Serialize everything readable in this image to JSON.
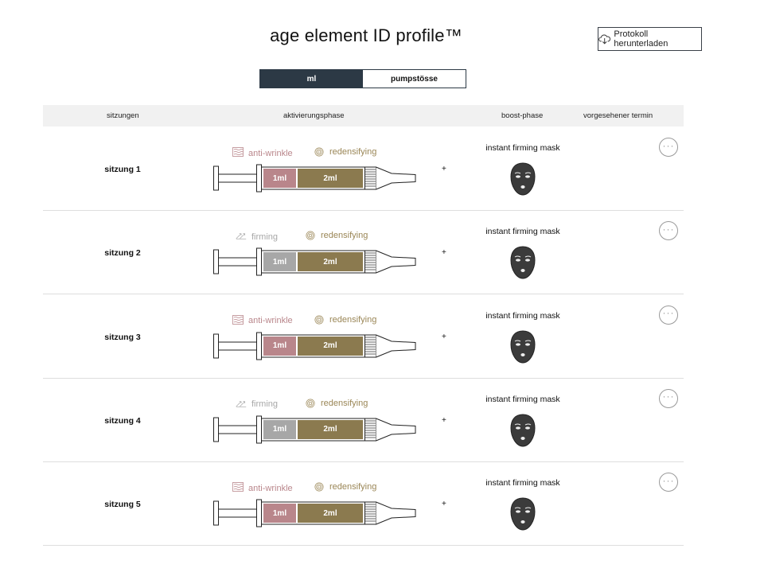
{
  "header": {
    "title": "age element ID profile™",
    "download_label": "Protokoll herunterladen"
  },
  "toggle": {
    "options": [
      "ml",
      "pumpstösse"
    ],
    "selected": "ml"
  },
  "columns": {
    "sessions": "sitzungen",
    "activation": "aktivierungsphase",
    "boost": "boost-phase",
    "appointment": "vorgesehener termin"
  },
  "colors": {
    "antiwrinkle": "#b9868b",
    "firming": "#a7a7a7",
    "redensifying": "#8b7a4f",
    "dark": "#2c3945"
  },
  "rows": [
    {
      "session": "sitzung 1",
      "product_a": "anti-wrinkle",
      "product_a_icon": "waves-icon",
      "product_b": "redensifying",
      "dose_a": "1ml",
      "dose_b": "2ml",
      "plus": "+",
      "boost": "instant firming mask",
      "appointment": "-",
      "more": "···"
    },
    {
      "session": "sitzung 2",
      "product_a": "firming",
      "product_a_icon": "arrows-up-icon",
      "product_b": "redensifying",
      "dose_a": "1ml",
      "dose_b": "2ml",
      "plus": "+",
      "boost": "instant firming mask",
      "appointment": "-",
      "more": "···"
    },
    {
      "session": "sitzung 3",
      "product_a": "anti-wrinkle",
      "product_a_icon": "waves-icon",
      "product_b": "redensifying",
      "dose_a": "1ml",
      "dose_b": "2ml",
      "plus": "+",
      "boost": "instant firming mask",
      "appointment": "-",
      "more": "···"
    },
    {
      "session": "sitzung 4",
      "product_a": "firming",
      "product_a_icon": "arrows-up-icon",
      "product_b": "redensifying",
      "dose_a": "1ml",
      "dose_b": "2ml",
      "plus": "+",
      "boost": "instant firming mask",
      "appointment": "-",
      "more": "···"
    },
    {
      "session": "sitzung 5",
      "product_a": "anti-wrinkle",
      "product_a_icon": "waves-icon",
      "product_b": "redensifying",
      "dose_a": "1ml",
      "dose_b": "2ml",
      "plus": "+",
      "boost": "instant firming mask",
      "appointment": "-",
      "more": "···"
    }
  ]
}
